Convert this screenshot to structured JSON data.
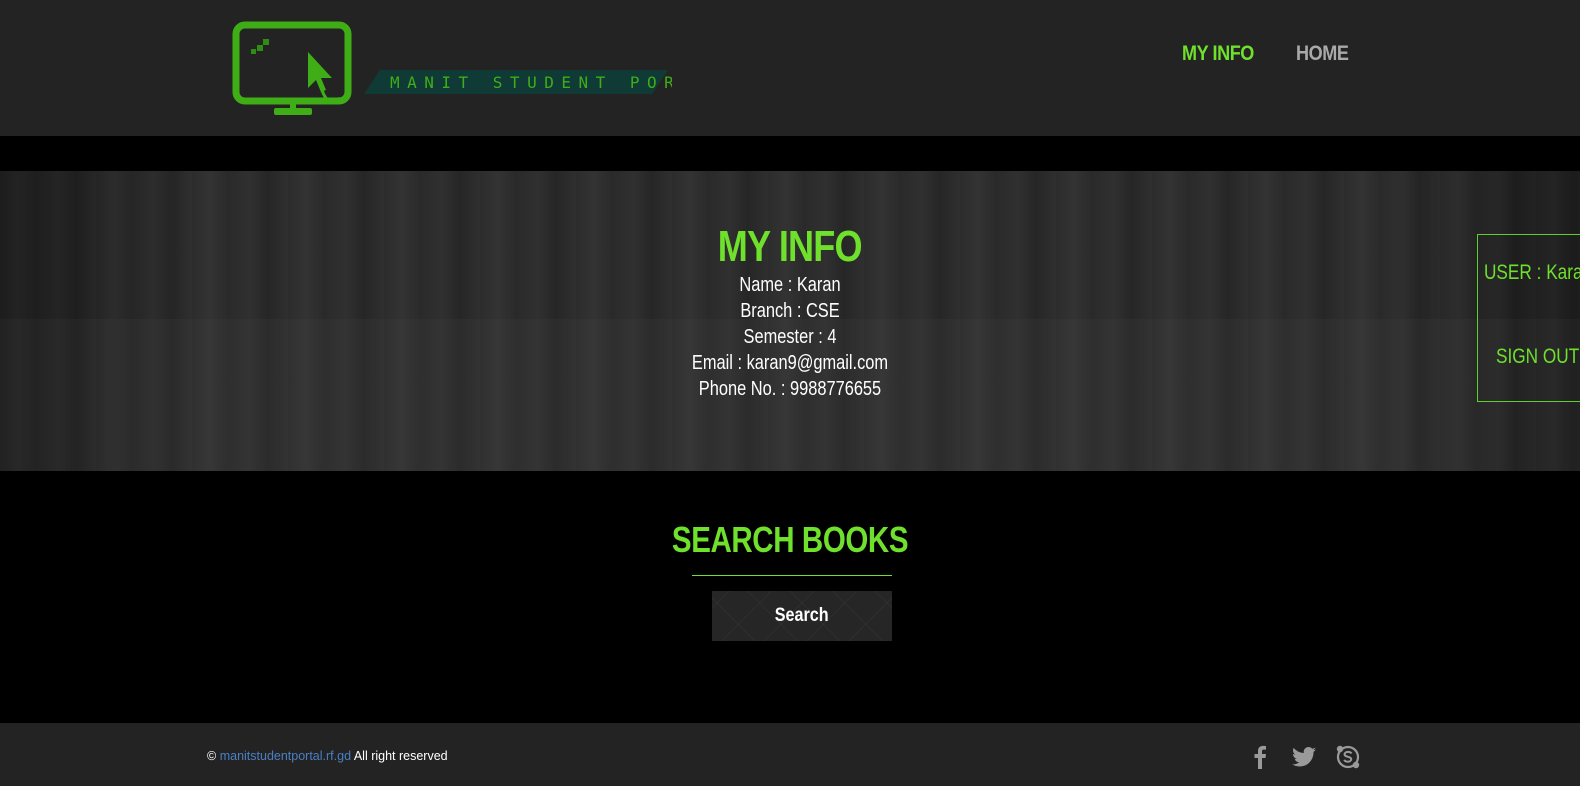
{
  "header": {
    "logo_text": "MANIT STUDENT PORTAL",
    "nav": [
      {
        "label": "MY INFO",
        "active": true
      },
      {
        "label": "HOME",
        "active": false
      }
    ]
  },
  "info": {
    "title": "MY INFO",
    "name": "Name : Karan",
    "branch": "Branch : CSE",
    "semester": "Semester : 4",
    "email": "Email : karan9@gmail.com",
    "phone": "Phone No. : 9988776655"
  },
  "user_panel": {
    "user": "USER : Karan",
    "signout": "SIGN OUT"
  },
  "search": {
    "title": "SEARCH BOOKS",
    "button": "Search"
  },
  "footer": {
    "copyright_symbol": "©",
    "site": "manitstudentportal.rf.gd",
    "rights": "All right reserved",
    "social": [
      "facebook-icon",
      "twitter-icon",
      "skype-icon"
    ]
  },
  "colors": {
    "accent": "#6fe02b",
    "header_bg": "#232323",
    "link": "#4a7fc4"
  }
}
